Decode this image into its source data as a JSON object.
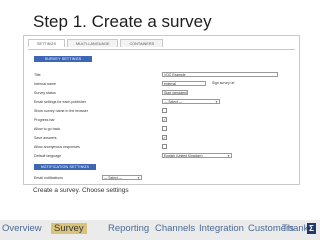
{
  "slide": {
    "title": "Step 1. Create a survey",
    "caption": "Create a survey. Choose settings"
  },
  "screenshot": {
    "tabs": [
      {
        "label": "SETTINGS",
        "active": true
      },
      {
        "label": "MULTI-LANGUAGE",
        "active": false
      },
      {
        "label": "CONTAINERS",
        "active": false
      }
    ],
    "survey_settings": {
      "header": "SURVEY SETTINGS",
      "fields": [
        {
          "label": "Title",
          "type": "text",
          "value": "VOC Example"
        },
        {
          "label": "Internal name",
          "type": "text",
          "value": "external",
          "side": "Sign survey url"
        },
        {
          "label": "Survey status",
          "type": "text",
          "value": "Start (gesloten)"
        },
        {
          "label": "Email settings for each publisher",
          "type": "select",
          "value": "— Select —"
        },
        {
          "label": "Show survey name in the browser",
          "type": "checkbox",
          "checked": false
        },
        {
          "label": "Progress bar",
          "type": "checkbox",
          "checked": true
        },
        {
          "label": "Allow to go back",
          "type": "checkbox",
          "checked": false
        },
        {
          "label": "Save answers",
          "type": "checkbox",
          "checked": true
        },
        {
          "label": "Allow anonymous responses",
          "type": "checkbox",
          "checked": false
        },
        {
          "label": "Default language",
          "type": "select",
          "value": "English (United Kingdom)"
        }
      ]
    },
    "notification_settings": {
      "header": "NOTIFICATION SETTINGS",
      "fields": [
        {
          "label": "Email notifications",
          "type": "select",
          "value": "— Select —"
        }
      ]
    }
  },
  "nav": {
    "items": [
      {
        "label": "Overview",
        "active": false
      },
      {
        "label": "Survey",
        "active": true
      },
      {
        "label": "Reporting",
        "active": false
      },
      {
        "label": "Channels",
        "active": false
      },
      {
        "label": "Integration",
        "active": false
      },
      {
        "label": "Customers",
        "active": false
      },
      {
        "label": "Thanks!",
        "active": false
      }
    ],
    "logo_icon": "brand-logo-icon"
  }
}
